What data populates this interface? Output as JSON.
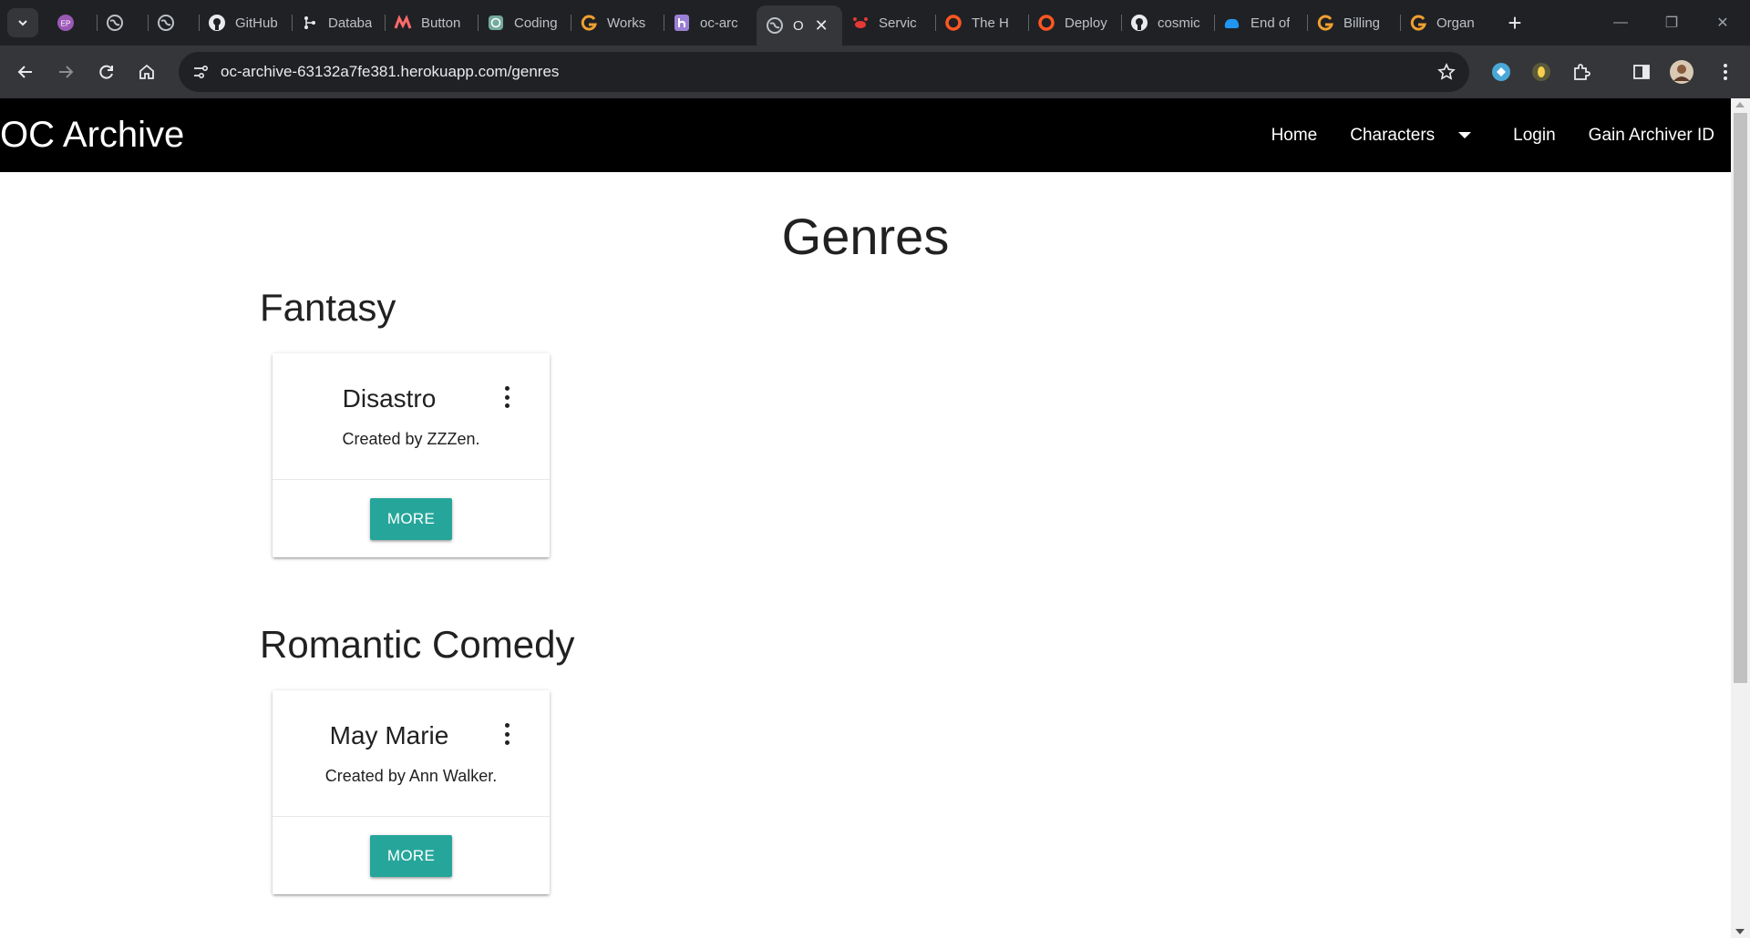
{
  "browser": {
    "tabs": [
      {
        "title": "",
        "icon": "profile-ep-icon",
        "color": "#9b59b6"
      },
      {
        "title": "",
        "icon": "globe-icon",
        "color": "#bdc1c6"
      },
      {
        "title": "",
        "icon": "globe-icon",
        "color": "#bdc1c6"
      },
      {
        "title": "GitHub",
        "icon": "github-icon",
        "color": "#e8eaed"
      },
      {
        "title": "Databa",
        "icon": "database-icon",
        "color": "#e8eaed"
      },
      {
        "title": "Button",
        "icon": "m-logo-icon",
        "color": "#ff6b6b"
      },
      {
        "title": "Coding",
        "icon": "openai-icon",
        "color": "#74aa9c"
      },
      {
        "title": "Works",
        "icon": "g-logo-icon",
        "color": "#f0a030"
      },
      {
        "title": "oc-arc",
        "icon": "heroku-icon",
        "color": "#9b7fd4"
      },
      {
        "title": "O",
        "icon": "globe-icon",
        "color": "#bdc1c6",
        "active": true
      },
      {
        "title": "Servic",
        "icon": "crab-icon",
        "color": "#e53935"
      },
      {
        "title": "The H",
        "icon": "ring-icon",
        "color": "#ff5722"
      },
      {
        "title": "Deploy",
        "icon": "ring-icon",
        "color": "#ff5722"
      },
      {
        "title": "cosmic",
        "icon": "github-icon",
        "color": "#e8eaed"
      },
      {
        "title": "End of",
        "icon": "cloud-icon",
        "color": "#2196f3"
      },
      {
        "title": "Billing",
        "icon": "g-logo-icon",
        "color": "#f0a030"
      },
      {
        "title": "Organ",
        "icon": "g-logo-icon",
        "color": "#f0a030"
      }
    ],
    "url": "oc-archive-63132a7fe381.herokuapp.com/genres"
  },
  "site": {
    "brand": "OC Archive",
    "nav": {
      "home": "Home",
      "characters": "Characters",
      "login": "Login",
      "gain_id": "Gain Archiver ID"
    },
    "page_title": "Genres",
    "genres": [
      {
        "name": "Fantasy",
        "card": {
          "character": "Disastro",
          "creator": "Created by ZZZen.",
          "button": "MORE"
        }
      },
      {
        "name": "Romantic Comedy",
        "card": {
          "character": "May Marie",
          "creator": "Created by Ann Walker.",
          "button": "MORE"
        }
      }
    ]
  },
  "colors": {
    "accent": "#26a69a",
    "navbar": "#000000",
    "chrome_dark": "#202124",
    "chrome_toolbar": "#35363a"
  }
}
